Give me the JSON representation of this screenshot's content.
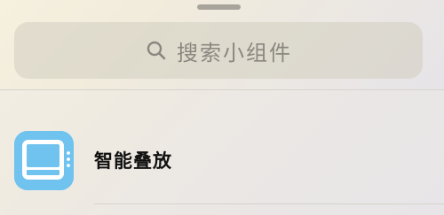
{
  "search": {
    "placeholder": "搜索小组件"
  },
  "widgets": [
    {
      "label": "智能叠放",
      "icon": "smart-stack-icon"
    }
  ],
  "colors": {
    "icon_background": "#6fc3ee",
    "placeholder_text": "#8a8780"
  }
}
